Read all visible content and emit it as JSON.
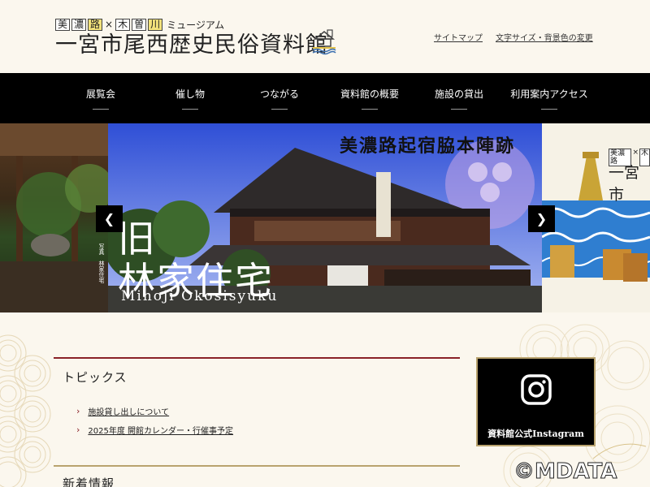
{
  "header": {
    "tagline": [
      {
        "text": "美",
        "boxed": true,
        "highlight": false
      },
      {
        "text": "濃",
        "boxed": true,
        "highlight": false
      },
      {
        "text": "路",
        "boxed": true,
        "highlight": true
      },
      {
        "text": "×",
        "boxed": false,
        "highlight": false
      },
      {
        "text": "木",
        "boxed": true,
        "highlight": false
      },
      {
        "text": "曽",
        "boxed": true,
        "highlight": false
      },
      {
        "text": "川",
        "boxed": true,
        "highlight": true
      },
      {
        "text": "ミュージアム",
        "boxed": false,
        "highlight": false
      }
    ],
    "site_title": "一宮市尾西歴史民俗資料館",
    "util_links": [
      "サイトマップ",
      "文字サイズ・背景色の変更"
    ]
  },
  "nav": {
    "items": [
      "展覧会",
      "催し物",
      "つながる",
      "資料館の概要",
      "施設の貸出",
      "利用案内アクセス"
    ]
  },
  "slider": {
    "main_caption_top": "美濃路起宿脇本陣跡",
    "main_caption_big_line1": "旧",
    "main_caption_big_line2": "林家住宅",
    "main_caption_roman": "Minoji Okosisyuku",
    "side_credit": "写真　林家住宅",
    "right_tagline_parts": [
      "美濃路",
      "×",
      "木"
    ],
    "right_title_fragment": "一宮市",
    "prev_icon": "chevron-left-icon",
    "next_icon": "chevron-right-icon"
  },
  "topics": {
    "title": "トピックス",
    "items": [
      "施設貸し出しについて",
      "2025年度 開館カレンダー・行催事予定"
    ]
  },
  "news": {
    "title": "新着情報"
  },
  "instagram": {
    "label": "資料館公式Instagram",
    "icon": "instagram-icon"
  },
  "watermark": "©MDATA",
  "colors": {
    "background": "#fbf7ee",
    "nav_bg": "#000000",
    "accent_red": "#8a2228",
    "accent_gold": "#b9a36e"
  }
}
